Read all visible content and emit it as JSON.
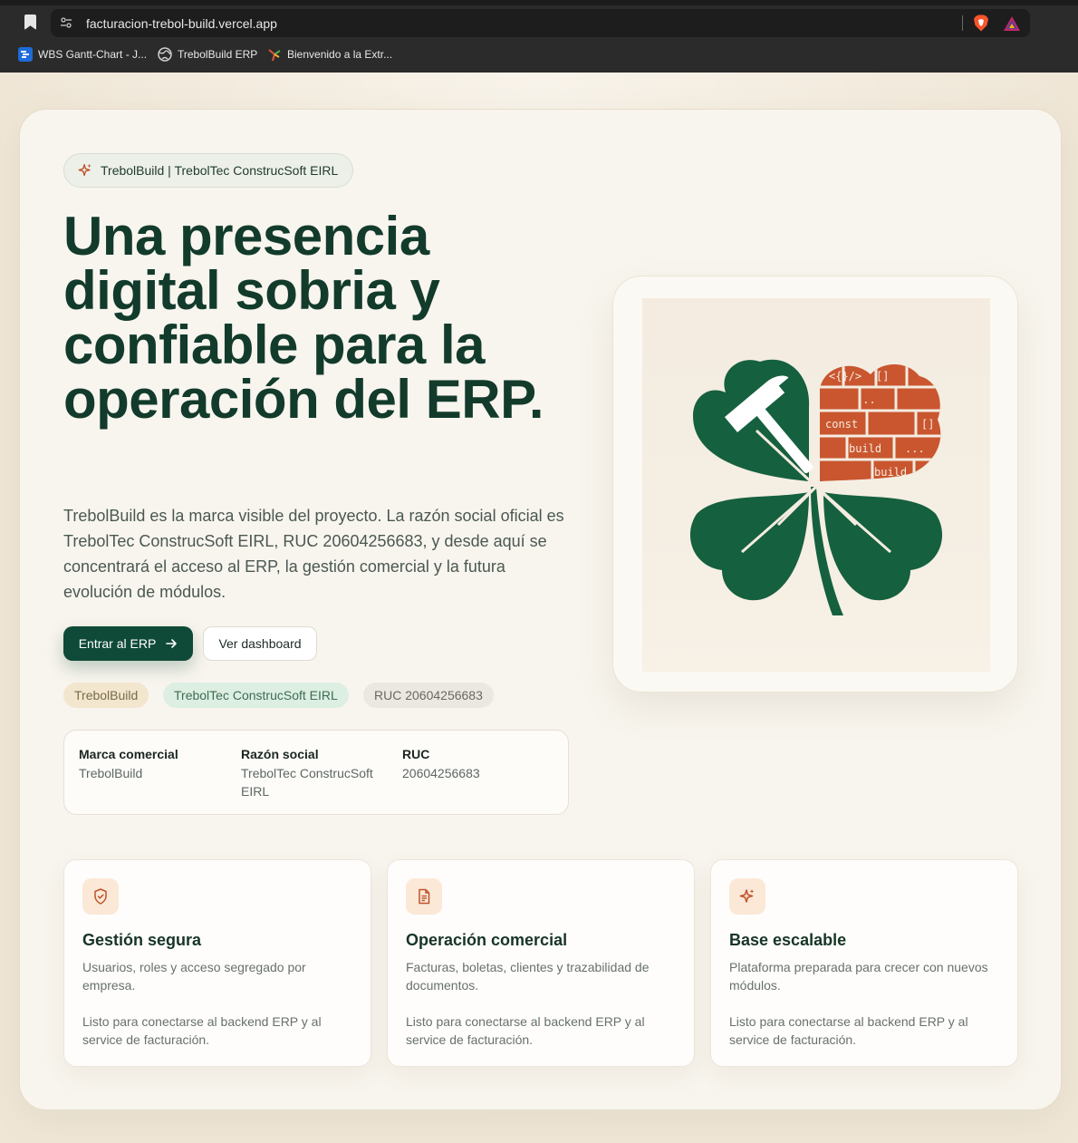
{
  "browser": {
    "url": "facturacion-trebol-build.vercel.app",
    "bookmarks": [
      {
        "label": "WBS Gantt-Chart - J...",
        "icon": "gantt-app-icon"
      },
      {
        "label": "TrebolBuild ERP",
        "icon": "globe-icon"
      },
      {
        "label": "Bienvenido a la Extr...",
        "icon": "bird-icon"
      }
    ]
  },
  "hero": {
    "pill": "TrebolBuild | TrebolTec ConstrucSoft EIRL",
    "headline": "Una presencia digital sobria y confiable para la operación del ERP.",
    "lead": "TrebolBuild es la marca visible del proyecto. La razón social oficial es TrebolTec ConstrucSoft EIRL, RUC 20604256683, y desde aquí se concentrará el acceso al ERP, la gestión comercial y la futura evolución de módulos.",
    "primary_button": "Entrar al ERP",
    "secondary_button": "Ver dashboard",
    "tags": [
      "TrebolBuild",
      "TrebolTec ConstrucSoft EIRL",
      "RUC 20604256683"
    ]
  },
  "facts": [
    {
      "label": "Marca comercial",
      "value": "TrebolBuild"
    },
    {
      "label": "Razón social",
      "value": "TrebolTec ConstrucSoft EIRL"
    },
    {
      "label": "RUC",
      "value": "20604256683"
    }
  ],
  "logo": {
    "code_words": [
      "<{}/>",
      "[]",
      "...",
      "const",
      "[]",
      "build",
      "...",
      "build"
    ]
  },
  "features": [
    {
      "icon": "shield-check-icon",
      "title": "Gestión segura",
      "desc": "Usuarios, roles y acceso segregado por empresa.",
      "note": "Listo para conectarse al backend ERP y al service de facturación."
    },
    {
      "icon": "document-icon",
      "title": "Operación comercial",
      "desc": "Facturas, boletas, clientes y trazabilidad de documentos.",
      "note": "Listo para conectarse al backend ERP y al service de facturación."
    },
    {
      "icon": "sparkles-icon",
      "title": "Base escalable",
      "desc": "Plataforma preparada para crecer con nuevos módulos.",
      "note": "Listo para conectarse al backend ERP y al service de facturación."
    }
  ],
  "colors": {
    "brand_green": "#0f4a38",
    "headline_green": "#123b2c",
    "brick_orange": "#c9562f",
    "page_bg": "#efe6d6"
  }
}
